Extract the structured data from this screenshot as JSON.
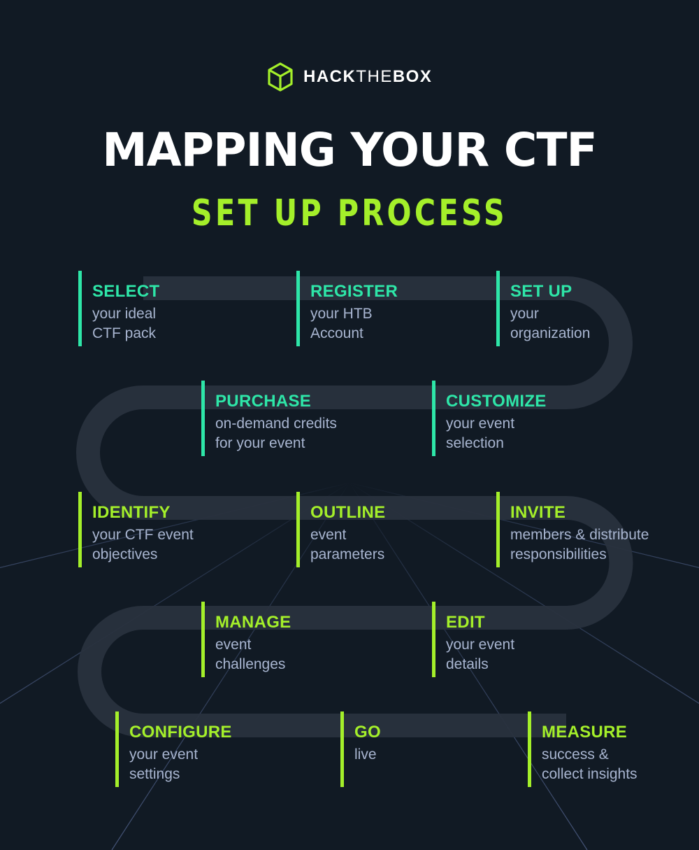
{
  "brand": {
    "logo_icon": "cube-icon",
    "name_bold_1": "HACK",
    "name_thin": "THE",
    "name_bold_2": "BOX"
  },
  "header": {
    "title": "MAPPING YOUR CTF",
    "subtitle": "SET UP PROCESS"
  },
  "colors": {
    "background": "#111a24",
    "road": "#29323e",
    "accent_teal": "#2ee6a8",
    "accent_lime": "#a4ef2a",
    "body_text": "#a8b5d0",
    "title_text": "#ffffff"
  },
  "steps": [
    {
      "heading": "SELECT",
      "line1": "your ideal",
      "line2": "CTF pack",
      "accent": "teal"
    },
    {
      "heading": "REGISTER",
      "line1": "your HTB",
      "line2": "Account",
      "accent": "teal"
    },
    {
      "heading": "SET UP",
      "line1": "your",
      "line2": "organization",
      "accent": "teal"
    },
    {
      "heading": "PURCHASE",
      "line1": "on-demand credits",
      "line2": "for your event",
      "accent": "teal"
    },
    {
      "heading": "CUSTOMIZE",
      "line1": "your event",
      "line2": "selection",
      "accent": "teal"
    },
    {
      "heading": "IDENTIFY",
      "line1": "your CTF event",
      "line2": "objectives",
      "accent": "lime"
    },
    {
      "heading": "OUTLINE",
      "line1": "event",
      "line2": "parameters",
      "accent": "lime"
    },
    {
      "heading": "INVITE",
      "line1": "members & distribute",
      "line2": "responsibilities",
      "accent": "lime"
    },
    {
      "heading": "MANAGE",
      "line1": "event",
      "line2": "challenges",
      "accent": "lime"
    },
    {
      "heading": "EDIT",
      "line1": "your event",
      "line2": "details",
      "accent": "lime"
    },
    {
      "heading": "CONFIGURE",
      "line1": "your event",
      "line2": "settings",
      "accent": "lime"
    },
    {
      "heading": "GO",
      "line1": "live",
      "line2": "",
      "accent": "lime"
    },
    {
      "heading": "MEASURE",
      "line1": "success &",
      "line2": "collect insights",
      "accent": "lime"
    }
  ]
}
